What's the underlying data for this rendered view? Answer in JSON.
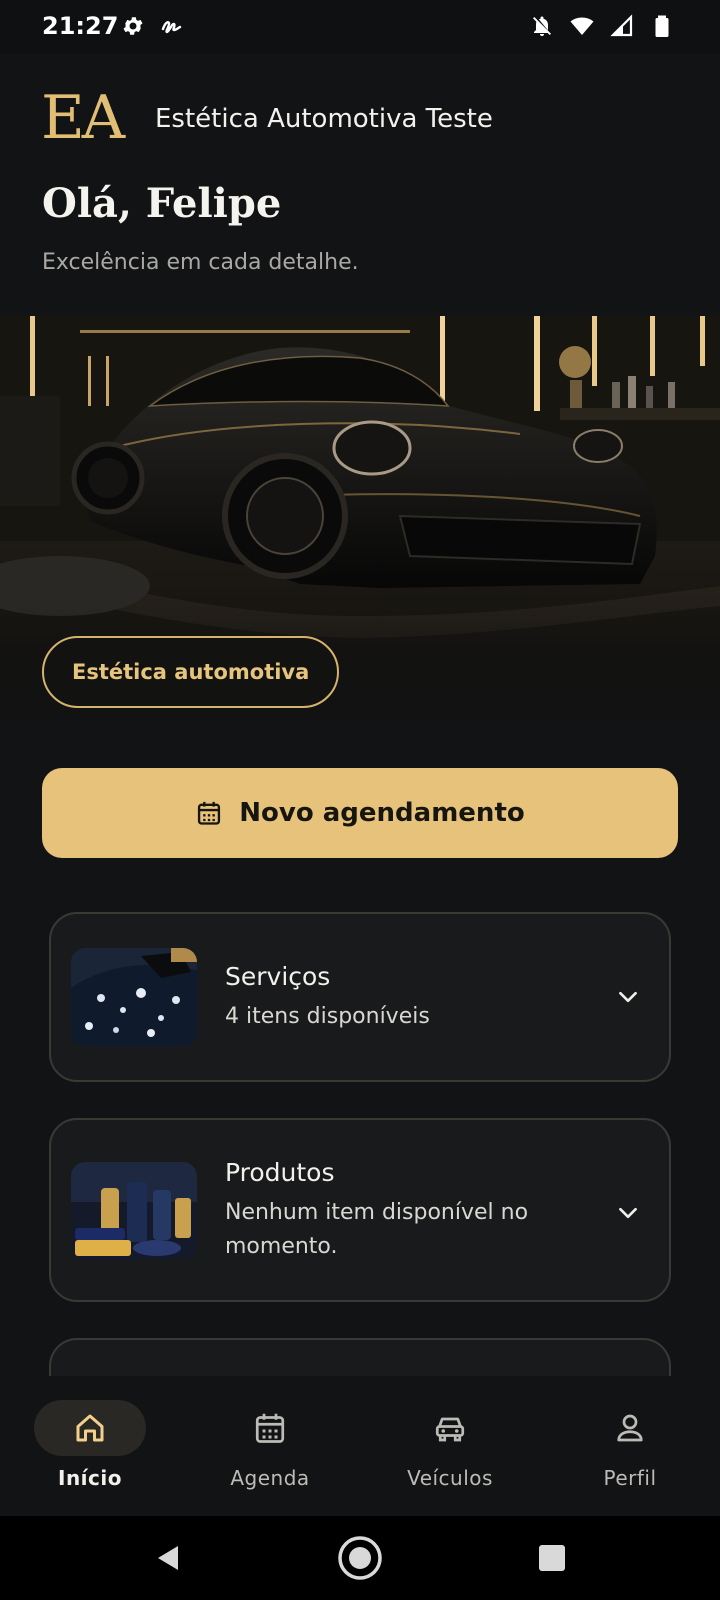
{
  "status_bar": {
    "time": "21:27",
    "left_icons": [
      "gear-icon",
      "signature-icon"
    ],
    "right_icons": [
      "bell-off-icon",
      "wifi-icon",
      "cell-signal-icon",
      "battery-icon"
    ]
  },
  "header": {
    "logo_text": "EA",
    "brand_name": "Estética Automotiva Teste",
    "greeting": "Olá, Felipe",
    "tagline": "Excelência em cada detalhe."
  },
  "hero": {
    "chip_label": "Estética automotiva"
  },
  "cta": {
    "label": "Novo agendamento",
    "icon": "calendar-icon"
  },
  "sections": [
    {
      "title": "Serviços",
      "subtitle": "4 itens disponíveis",
      "icon": "chevron-down-icon"
    },
    {
      "title": "Produtos",
      "subtitle": "Nenhum item disponível no momento.",
      "icon": "chevron-down-icon"
    }
  ],
  "bottom_nav": {
    "items": [
      {
        "label": "Início",
        "icon": "home-icon",
        "active": true
      },
      {
        "label": "Agenda",
        "icon": "calendar-icon",
        "active": false
      },
      {
        "label": "Veículos",
        "icon": "car-icon",
        "active": false
      },
      {
        "label": "Perfil",
        "icon": "person-icon",
        "active": false
      }
    ]
  },
  "colors": {
    "accent": "#e6c27b",
    "background": "#121314",
    "card": "#181a1b",
    "card_border": "#3a3934"
  }
}
